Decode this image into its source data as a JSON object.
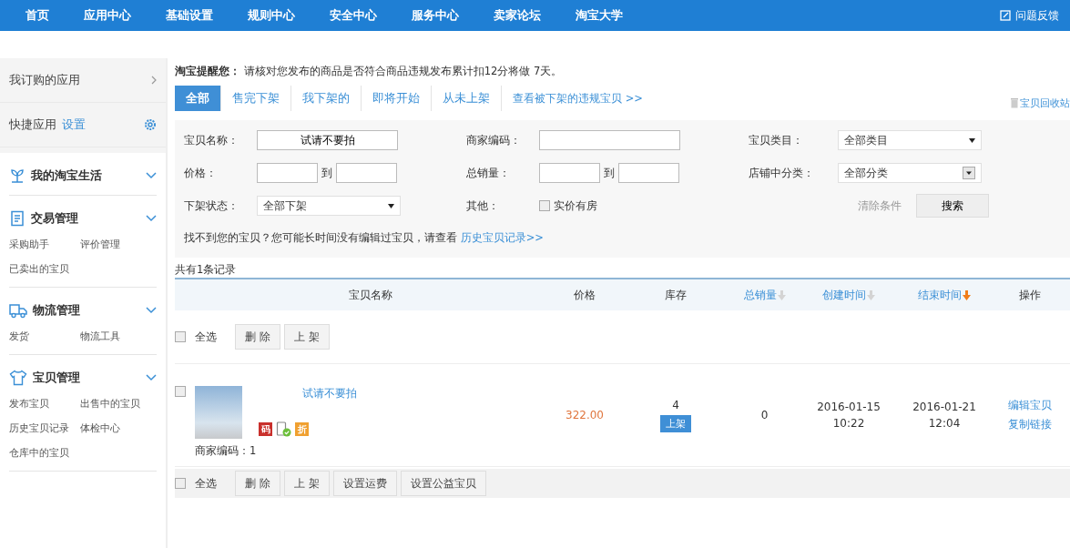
{
  "nav": {
    "items": [
      "首页",
      "应用中心",
      "基础设置",
      "规则中心",
      "安全中心",
      "服务中心",
      "卖家论坛",
      "淘宝大学"
    ],
    "feedback": "问题反馈"
  },
  "sidebar": {
    "subscribed": "我订购的应用",
    "quick": "快捷应用",
    "quick_setting": "设置",
    "groups": [
      {
        "title": "我的淘宝生活"
      },
      {
        "title": "交易管理",
        "links": [
          "采购助手",
          "评价管理",
          "已卖出的宝贝"
        ]
      },
      {
        "title": "物流管理",
        "links": [
          "发货",
          "物流工具"
        ]
      },
      {
        "title": "宝贝管理",
        "links": [
          "发布宝贝",
          "出售中的宝贝",
          "历史宝贝记录",
          "体检中心",
          "仓库中的宝贝"
        ]
      }
    ]
  },
  "notice": "**淘宝提醒您：** 请核对您发布的商品是否符合商品违规发布累计扣12分将做 7天。",
  "tabs": [
    {
      "label": "全部",
      "selected": true
    },
    {
      "label": "售完下架",
      "selected": false
    },
    {
      "label": "我下架的",
      "selected": false
    },
    {
      "label": "即将开始",
      "selected": false
    },
    {
      "label": "从未上架",
      "selected": false
    }
  ],
  "violation_link": "查看被下架的违规宝贝 >>",
  "recycle": "宝贝回收站",
  "filters": [
    {
      "kind": "text",
      "label": "宝贝名称：",
      "value": "试请不要拍"
    },
    {
      "kind": "text",
      "label": "商家编码："
    },
    {
      "kind": "select",
      "label": "宝贝类目：",
      "value": "全部类目"
    },
    {
      "kind": "range",
      "label": "价格：",
      "to": "到"
    },
    {
      "kind": "range",
      "label": "总销量：",
      "to": "到"
    },
    {
      "kind": "combo",
      "label": "店铺中分类：",
      "value": "全部分类"
    },
    {
      "kind": "select",
      "label": "下架状态：",
      "value": "全部下架"
    },
    {
      "kind": "checkbox",
      "label": "其他：",
      "option": "实价有房",
      "checked": false
    },
    {
      "kind": "actions",
      "clear": "清除条件",
      "search": "搜索"
    }
  ],
  "hint": "找不到您的宝贝？您可能长时间没有编辑过宝贝，请查看",
  "hint_link": "历史宝贝记录>>",
  "count": "共有1条记录",
  "columns": [
    {
      "label": "宝贝名称",
      "sortable": false,
      "sort_active": false
    },
    {
      "label": "价格",
      "sortable": false,
      "sort_active": false
    },
    {
      "label": "库存",
      "sortable": false,
      "sort_active": false
    },
    {
      "label": "总销量",
      "sortable": true,
      "sort_active": false
    },
    {
      "label": "创建时间",
      "sortable": true,
      "sort_active": false
    },
    {
      "label": "结束时间",
      "sortable": true,
      "sort_active": true
    },
    {
      "label": "操作",
      "sortable": false,
      "sort_active": false
    }
  ],
  "batch_top": {
    "select_all": "全选",
    "checked": false,
    "buttons": [
      "删 除",
      "上 架"
    ]
  },
  "rows": [
    {
      "checked": false,
      "title": "试请不要拍",
      "badges": [
        {
          "kind": "text",
          "label": "码"
        },
        {
          "kind": "mobile"
        },
        {
          "kind": "discount",
          "label": "折"
        }
      ],
      "merchant_code": "商家编码：1",
      "price": "322.00",
      "stock": "4",
      "stock_button": "上架",
      "sales": "0",
      "created": [
        "2016-01-15",
        "10:22"
      ],
      "ended": [
        "2016-01-21",
        "12:04"
      ],
      "actions": [
        "编辑宝贝",
        "复制链接"
      ]
    }
  ],
  "batch_bottom": {
    "select_all": "全选",
    "checked": false,
    "buttons": [
      "删 除",
      "上 架",
      "设置运费",
      "设置公益宝贝"
    ]
  }
}
